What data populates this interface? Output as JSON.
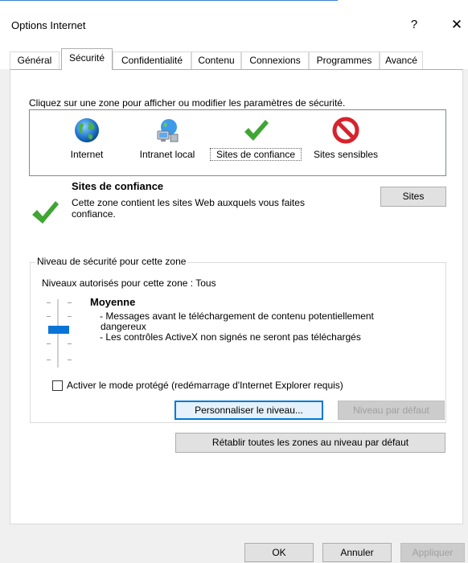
{
  "window": {
    "title": "Options Internet",
    "help_label": "?",
    "close_label": "✕"
  },
  "tabs": [
    {
      "label": "Général",
      "active": false
    },
    {
      "label": "Sécurité",
      "active": true
    },
    {
      "label": "Confidentialité",
      "active": false
    },
    {
      "label": "Contenu",
      "active": false
    },
    {
      "label": "Connexions",
      "active": false
    },
    {
      "label": "Programmes",
      "active": false
    },
    {
      "label": "Avancé",
      "active": false
    }
  ],
  "zones": {
    "instruction": "Cliquez sur une zone pour afficher ou modifier les paramètres de sécurité.",
    "items": [
      {
        "label": "Internet",
        "icon": "globe-icon"
      },
      {
        "label": "Intranet local",
        "icon": "network-icon"
      },
      {
        "label": "Sites de confiance",
        "icon": "checkmark-icon",
        "selected": true
      },
      {
        "label": "Sites sensibles",
        "icon": "restricted-icon"
      }
    ]
  },
  "selected_zone": {
    "title": "Sites de confiance",
    "description": "Cette zone contient les sites Web auxquels vous faites confiance.",
    "sites_button": "Sites"
  },
  "security_level": {
    "group_title": "Niveau de sécurité pour cette zone",
    "allowed_levels": "Niveaux autorisés pour cette zone : Tous",
    "level_name": "Moyenne",
    "level_position": 0.5,
    "descriptions": [
      "- Messages avant le téléchargement de contenu potentiellement",
      "dangereux",
      "- Les contrôles ActiveX non signés ne seront pas téléchargés"
    ],
    "protected_mode_label": "Activer le mode protégé (redémarrage d'Internet Explorer requis)",
    "protected_mode_checked": false,
    "custom_level_button": "Personnaliser le niveau...",
    "default_level_button": "Niveau par défaut"
  },
  "reset_all_button": "Rétablir toutes les zones au niveau par défaut",
  "footer": {
    "ok": "OK",
    "cancel": "Annuler",
    "apply": "Appliquer"
  },
  "colors": {
    "accent": "#0078d7",
    "slider_thumb": "#0a74d6",
    "check_green": "#3fa535",
    "restricted_red": "#d6232d"
  }
}
